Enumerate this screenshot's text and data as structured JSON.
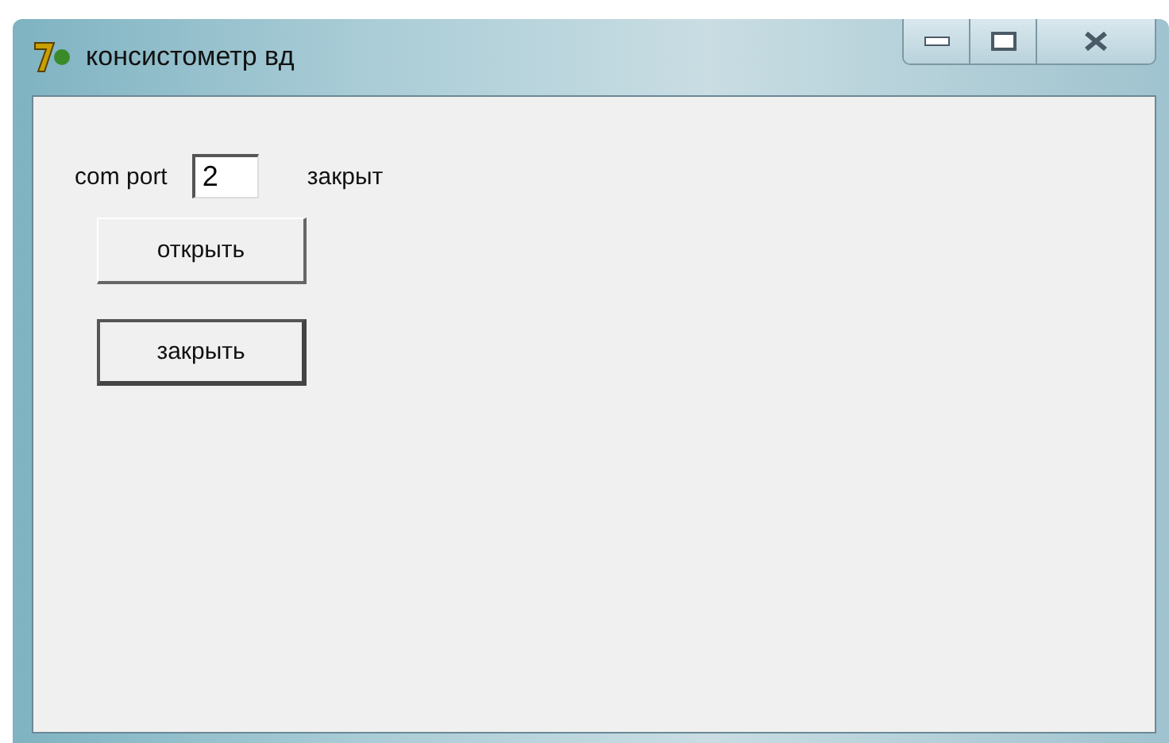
{
  "window": {
    "title": "консистометр вд"
  },
  "port": {
    "label": "com port",
    "value": "2",
    "status": "закрыт"
  },
  "buttons": [
    {
      "label": "открыть",
      "focused": false
    },
    {
      "label": "закрыть",
      "focused": true
    }
  ]
}
